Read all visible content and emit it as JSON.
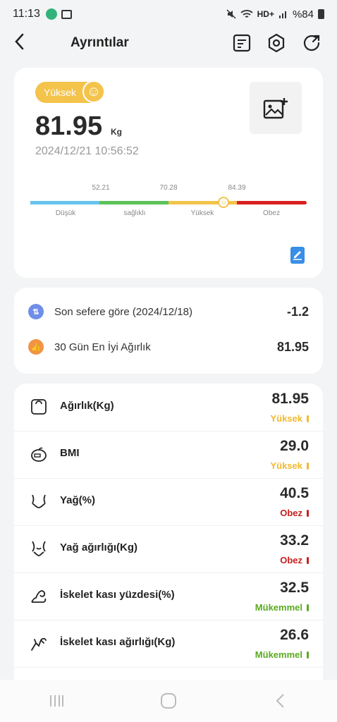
{
  "status_bar": {
    "time": "11:13",
    "battery": "%84",
    "network": "HD+"
  },
  "header": {
    "title": "Ayrıntılar",
    "icons": [
      "back-icon",
      "report-icon",
      "settings-icon",
      "share-icon"
    ]
  },
  "summary": {
    "badge": "Yüksek",
    "weight": "81.95",
    "unit": "Kg",
    "datetime": "2024/12/21 10:56:52",
    "scale": {
      "marks": [
        "52.21",
        "70.28",
        "84.39"
      ],
      "segments": [
        {
          "label": "Düşük",
          "color": "#66c3ec"
        },
        {
          "label": "sağlıklı",
          "color": "#5cc25a"
        },
        {
          "label": "Yüksek",
          "color": "#f3c34b"
        },
        {
          "label": "Obez",
          "color": "#d92020"
        }
      ],
      "pointer_fraction": 0.7
    }
  },
  "comparison": [
    {
      "label": "Son sefere göre (2024/12/18)",
      "value": "-1.2",
      "icon": "compare-icon",
      "color": "#6f8ee8"
    },
    {
      "label": "30 Gün En İyi Ağırlık",
      "value": "81.95",
      "icon": "thumbs-up-icon",
      "color": "#f19445"
    }
  ],
  "metrics": [
    {
      "label": "Ağırlık(Kg)",
      "value": "81.95",
      "status": "Yüksek",
      "status_color": "#f0b92e",
      "icon": "scale-icon"
    },
    {
      "label": "BMI",
      "value": "29.0",
      "status": "Yüksek",
      "status_color": "#f0b92e",
      "icon": "bmi-icon"
    },
    {
      "label": "Yağ(%)",
      "value": "40.5",
      "status": "Obez",
      "status_color": "#c81e1e",
      "icon": "body-fat-icon"
    },
    {
      "label": "Yağ ağırlığı(Kg)",
      "value": "33.2",
      "status": "Obez",
      "status_color": "#c81e1e",
      "icon": "fat-weight-icon"
    },
    {
      "label": "İskelet kası yüzdesi(%)",
      "value": "32.5",
      "status": "Mükemmel",
      "status_color": "#5aaa1f",
      "icon": "muscle-icon"
    },
    {
      "label": "İskelet kası ağırlığı(Kg)",
      "value": "26.6",
      "status": "Mükemmel",
      "status_color": "#5aaa1f",
      "icon": "muscle-weight-icon"
    }
  ]
}
